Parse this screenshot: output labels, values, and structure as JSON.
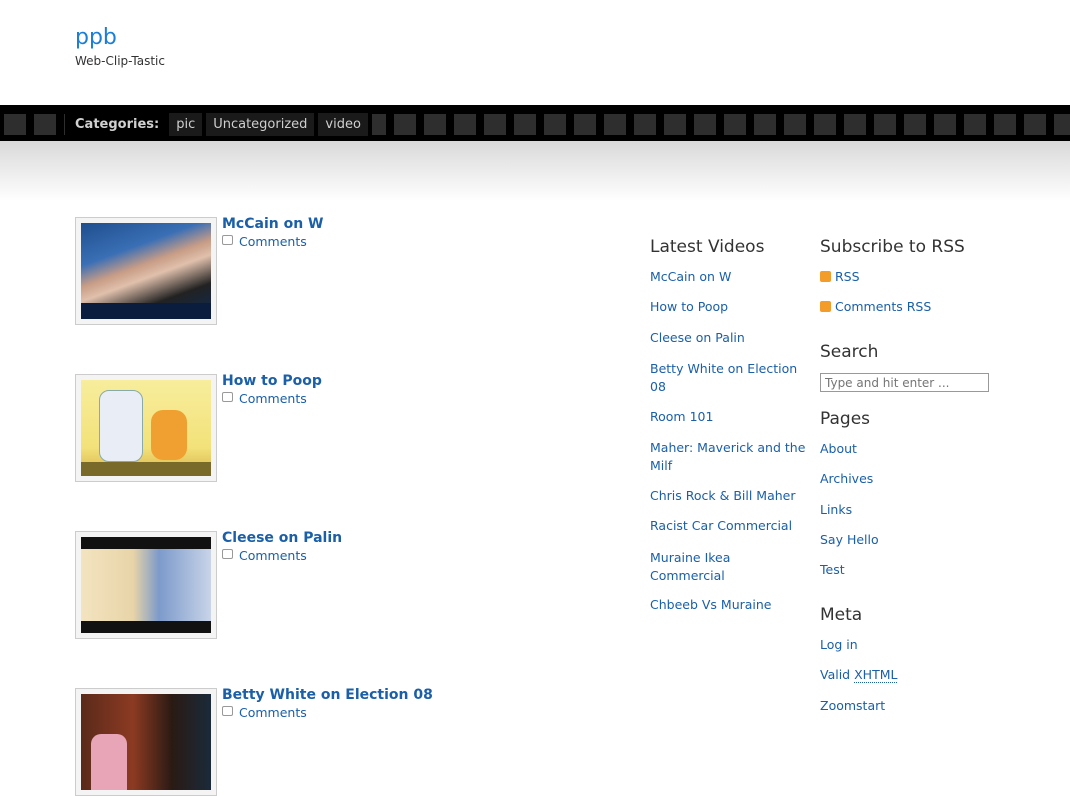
{
  "site": {
    "title": "ppb",
    "tagline": "Web-Clip-Tastic"
  },
  "categories": {
    "label": "Categories:",
    "items": [
      "pic",
      "Uncategorized",
      "video"
    ]
  },
  "posts": [
    {
      "title": "McCain on W",
      "comments": "Comments"
    },
    {
      "title": "How to Poop",
      "comments": "Comments"
    },
    {
      "title": "Cleese on Palin",
      "comments": "Comments"
    },
    {
      "title": "Betty White on Election 08",
      "comments": "Comments"
    }
  ],
  "latest_videos": {
    "heading": "Latest Videos",
    "items": [
      "McCain on W",
      "How to Poop",
      "Cleese on Palin",
      "Betty White on Election 08",
      "Room 101",
      "Maher: Maverick and the Milf",
      "Chris Rock & Bill Maher",
      "Racist Car Commercial",
      "Muraine Ikea Commercial",
      "Chbeeb Vs Muraine"
    ]
  },
  "subscribe": {
    "heading": "Subscribe to RSS",
    "rss": "RSS",
    "comments_rss": "Comments RSS"
  },
  "search": {
    "heading": "Search",
    "placeholder": "Type and hit enter ..."
  },
  "pages": {
    "heading": "Pages",
    "items": [
      "About",
      "Archives",
      "Links",
      "Say Hello",
      "Test"
    ]
  },
  "meta": {
    "heading": "Meta",
    "log_in": "Log in",
    "valid": "Valid",
    "xhtml": "XHTML",
    "zoomstart": "Zoomstart"
  }
}
